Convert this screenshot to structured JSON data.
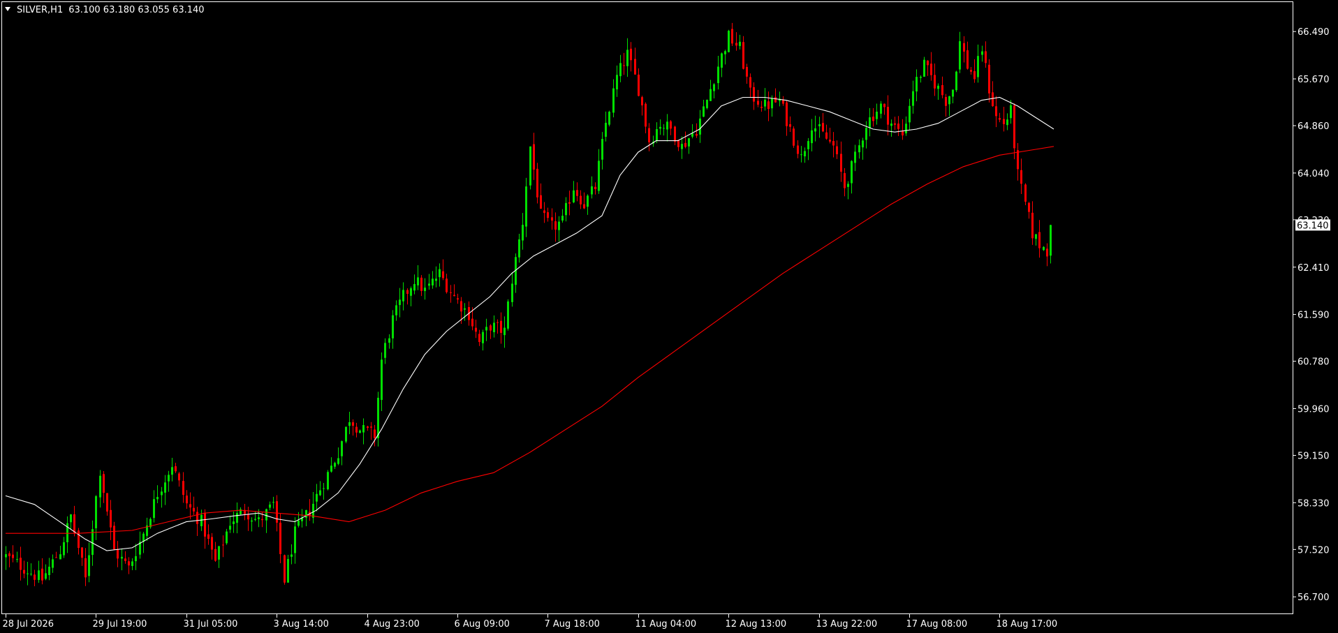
{
  "header": {
    "symbol": "SILVER,H1",
    "ohlc": "63.100 63.180 63.055 63.140"
  },
  "colors": {
    "background": "#000000",
    "frame": "#ffffff",
    "text": "#ffffff",
    "bull": "#00e000",
    "bear": "#ff0000",
    "ma_fast": "#ffffff",
    "ma_slow": "#ff0000",
    "price_label_bg": "#ffffff",
    "price_label_text": "#000000"
  },
  "icons": {
    "menu": "triangle-down-icon"
  },
  "chart_data": {
    "type": "candlestick",
    "timeframe": "H1",
    "ylim": [
      56.4,
      67.0
    ],
    "grid": false,
    "y_ticks": [
      "66.490",
      "65.670",
      "64.860",
      "64.040",
      "63.230",
      "62.410",
      "61.590",
      "60.780",
      "59.960",
      "59.150",
      "58.330",
      "57.520",
      "56.700"
    ],
    "x_ticks": [
      {
        "label": "28 Jul 2026",
        "bar": 0
      },
      {
        "label": "29 Jul 19:00",
        "bar": 25
      },
      {
        "label": "31 Jul 05:00",
        "bar": 50
      },
      {
        "label": "3 Aug 14:00",
        "bar": 75
      },
      {
        "label": "4 Aug 23:00",
        "bar": 100
      },
      {
        "label": "6 Aug 09:00",
        "bar": 125
      },
      {
        "label": "7 Aug 18:00",
        "bar": 150
      },
      {
        "label": "11 Aug 04:00",
        "bar": 175
      },
      {
        "label": "12 Aug 13:00",
        "bar": 200
      },
      {
        "label": "13 Aug 22:00",
        "bar": 225
      },
      {
        "label": "17 Aug 08:00",
        "bar": 250
      },
      {
        "label": "18 Aug 17:00",
        "bar": 275
      }
    ],
    "bars_visible": 290,
    "last_price": "63.140",
    "last_value": 63.14,
    "close_path": [
      [
        0,
        57.4
      ],
      [
        5,
        57.2
      ],
      [
        10,
        57.0
      ],
      [
        15,
        57.5
      ],
      [
        18,
        58.1
      ],
      [
        22,
        57.0
      ],
      [
        26,
        58.9
      ],
      [
        30,
        57.5
      ],
      [
        34,
        57.2
      ],
      [
        38,
        57.8
      ],
      [
        42,
        58.5
      ],
      [
        46,
        59.0
      ],
      [
        50,
        58.3
      ],
      [
        54,
        58.0
      ],
      [
        58,
        57.3
      ],
      [
        62,
        58.0
      ],
      [
        66,
        58.2
      ],
      [
        70,
        58.0
      ],
      [
        74,
        58.3
      ],
      [
        77,
        57.0
      ],
      [
        80,
        57.8
      ],
      [
        84,
        58.2
      ],
      [
        88,
        58.7
      ],
      [
        92,
        59.2
      ],
      [
        95,
        59.8
      ],
      [
        98,
        59.6
      ],
      [
        102,
        59.5
      ],
      [
        104,
        60.8
      ],
      [
        107,
        61.5
      ],
      [
        110,
        61.9
      ],
      [
        113,
        62.2
      ],
      [
        116,
        62.0
      ],
      [
        120,
        62.3
      ],
      [
        124,
        61.9
      ],
      [
        128,
        61.6
      ],
      [
        131,
        61.1
      ],
      [
        134,
        61.4
      ],
      [
        138,
        61.3
      ],
      [
        140,
        62.2
      ],
      [
        143,
        63.2
      ],
      [
        145,
        64.5
      ],
      [
        148,
        63.3
      ],
      [
        151,
        63.1
      ],
      [
        154,
        63.2
      ],
      [
        157,
        63.8
      ],
      [
        160,
        63.5
      ],
      [
        163,
        63.8
      ],
      [
        166,
        64.9
      ],
      [
        169,
        65.7
      ],
      [
        172,
        66.1
      ],
      [
        175,
        65.5
      ],
      [
        178,
        64.6
      ],
      [
        181,
        64.9
      ],
      [
        184,
        64.8
      ],
      [
        187,
        64.5
      ],
      [
        191,
        64.8
      ],
      [
        194,
        65.3
      ],
      [
        197,
        65.9
      ],
      [
        200,
        66.4
      ],
      [
        203,
        66.2
      ],
      [
        206,
        65.4
      ],
      [
        210,
        65.2
      ],
      [
        214,
        65.3
      ],
      [
        217,
        64.8
      ],
      [
        220,
        64.3
      ],
      [
        223,
        64.9
      ],
      [
        226,
        64.7
      ],
      [
        229,
        64.5
      ],
      [
        232,
        63.8
      ],
      [
        235,
        64.3
      ],
      [
        238,
        64.9
      ],
      [
        242,
        65.2
      ],
      [
        245,
        64.9
      ],
      [
        248,
        64.7
      ],
      [
        251,
        65.5
      ],
      [
        254,
        65.9
      ],
      [
        257,
        65.6
      ],
      [
        260,
        65.3
      ],
      [
        262,
        65.5
      ],
      [
        264,
        66.3
      ],
      [
        266,
        65.9
      ],
      [
        268,
        65.7
      ],
      [
        270,
        66.2
      ],
      [
        272,
        65.5
      ],
      [
        274,
        65.0
      ],
      [
        276,
        64.9
      ],
      [
        278,
        65.1
      ],
      [
        280,
        64.0
      ],
      [
        282,
        63.5
      ],
      [
        284,
        63.0
      ],
      [
        286,
        62.8
      ],
      [
        288,
        62.7
      ],
      [
        289,
        63.14
      ]
    ],
    "series": [
      {
        "style": "white-line",
        "points": [
          [
            0,
            58.45
          ],
          [
            8,
            58.3
          ],
          [
            15,
            58.0
          ],
          [
            22,
            57.7
          ],
          [
            28,
            57.5
          ],
          [
            35,
            57.55
          ],
          [
            42,
            57.8
          ],
          [
            50,
            58.0
          ],
          [
            57,
            58.05
          ],
          [
            63,
            58.1
          ],
          [
            70,
            58.15
          ],
          [
            75,
            58.05
          ],
          [
            80,
            58.0
          ],
          [
            86,
            58.2
          ],
          [
            92,
            58.5
          ],
          [
            98,
            59.0
          ],
          [
            104,
            59.6
          ],
          [
            110,
            60.3
          ],
          [
            116,
            60.9
          ],
          [
            122,
            61.3
          ],
          [
            128,
            61.6
          ],
          [
            134,
            61.9
          ],
          [
            140,
            62.3
          ],
          [
            146,
            62.6
          ],
          [
            152,
            62.8
          ],
          [
            158,
            63.0
          ],
          [
            165,
            63.3
          ],
          [
            170,
            64.0
          ],
          [
            175,
            64.4
          ],
          [
            180,
            64.6
          ],
          [
            186,
            64.6
          ],
          [
            192,
            64.8
          ],
          [
            198,
            65.2
          ],
          [
            204,
            65.35
          ],
          [
            210,
            65.35
          ],
          [
            216,
            65.3
          ],
          [
            222,
            65.2
          ],
          [
            228,
            65.1
          ],
          [
            234,
            64.95
          ],
          [
            240,
            64.8
          ],
          [
            246,
            64.75
          ],
          [
            252,
            64.8
          ],
          [
            258,
            64.9
          ],
          [
            264,
            65.1
          ],
          [
            270,
            65.3
          ],
          [
            275,
            65.35
          ],
          [
            280,
            65.2
          ],
          [
            285,
            65.0
          ],
          [
            290,
            64.8
          ]
        ]
      },
      {
        "style": "red-line",
        "points": [
          [
            0,
            57.8
          ],
          [
            20,
            57.8
          ],
          [
            35,
            57.85
          ],
          [
            45,
            58.0
          ],
          [
            55,
            58.15
          ],
          [
            65,
            58.2
          ],
          [
            75,
            58.15
          ],
          [
            85,
            58.1
          ],
          [
            95,
            58.0
          ],
          [
            105,
            58.2
          ],
          [
            115,
            58.5
          ],
          [
            125,
            58.7
          ],
          [
            135,
            58.85
          ],
          [
            145,
            59.2
          ],
          [
            155,
            59.6
          ],
          [
            165,
            60.0
          ],
          [
            175,
            60.5
          ],
          [
            185,
            60.95
          ],
          [
            195,
            61.4
          ],
          [
            205,
            61.85
          ],
          [
            215,
            62.3
          ],
          [
            225,
            62.7
          ],
          [
            235,
            63.1
          ],
          [
            245,
            63.5
          ],
          [
            255,
            63.85
          ],
          [
            265,
            64.15
          ],
          [
            275,
            64.35
          ],
          [
            285,
            64.45
          ],
          [
            290,
            64.5
          ]
        ]
      }
    ]
  }
}
